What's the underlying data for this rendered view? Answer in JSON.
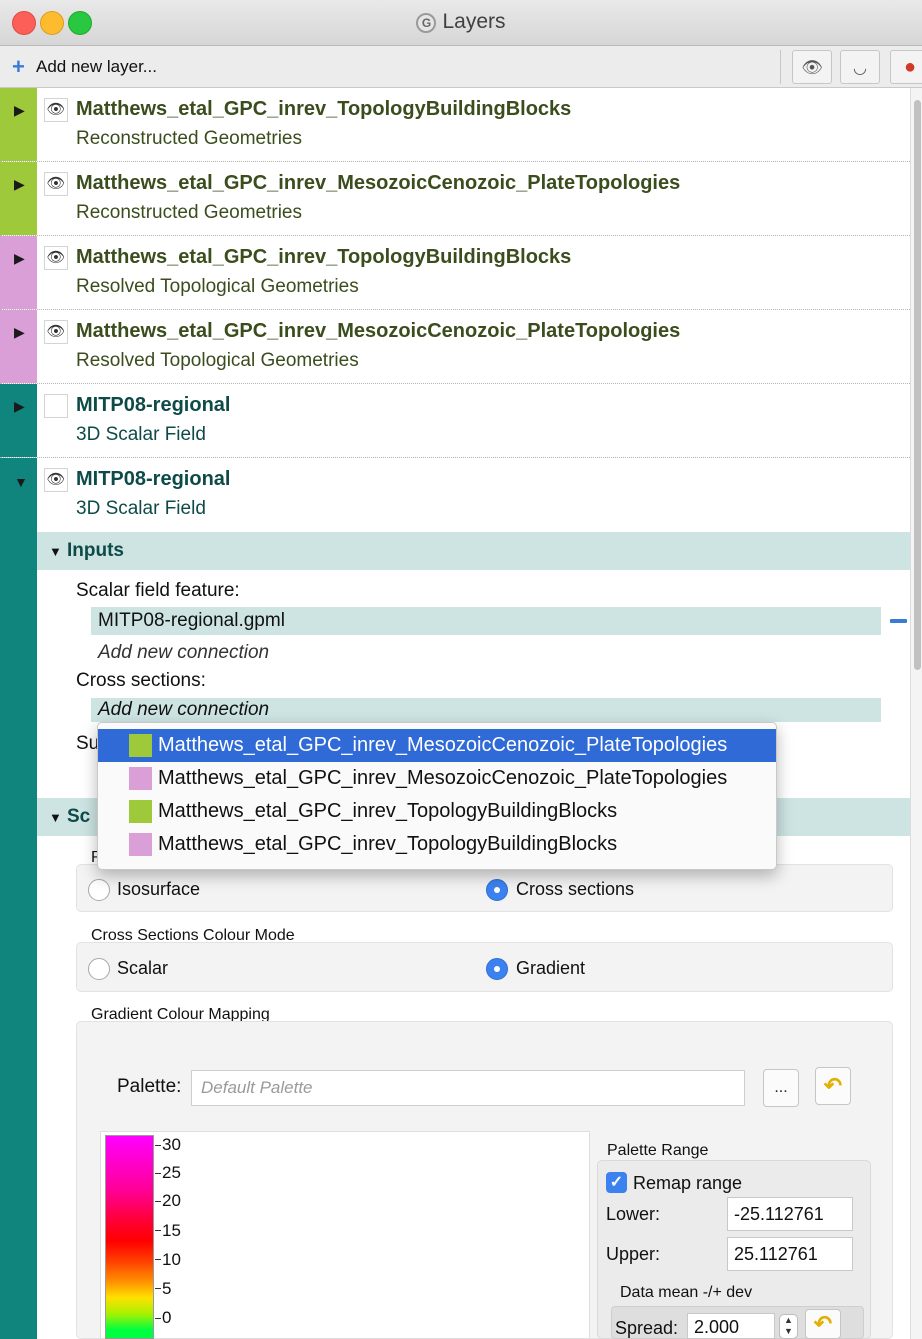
{
  "window": {
    "title": "Layers",
    "app_icon": "G"
  },
  "toolbar": {
    "add_layer_label": "Add new layer...",
    "buttons": [
      {
        "name": "show-all-layers",
        "icon": "eye-icon",
        "glyph": "👁"
      },
      {
        "name": "hide-all-layers",
        "icon": "eye-closed-icon",
        "glyph": "◡"
      },
      {
        "name": "layer-colors",
        "icon": "color-balls-icon",
        "glyph": "●"
      }
    ]
  },
  "layers": [
    {
      "name": "Matthews_etal_GPC_inrev_TopologyBuildingBlocks",
      "type": "Reconstructed Geometries",
      "color": "#9dc93a",
      "visible": true,
      "expanded": false
    },
    {
      "name": "Matthews_etal_GPC_inrev_MesozoicCenozoic_PlateTopologies",
      "type": "Reconstructed Geometries",
      "color": "#9dc93a",
      "visible": true,
      "expanded": false
    },
    {
      "name": "Matthews_etal_GPC_inrev_TopologyBuildingBlocks",
      "type": "Resolved Topological Geometries",
      "color": "#d99fd6",
      "visible": true,
      "expanded": false
    },
    {
      "name": "Matthews_etal_GPC_inrev_MesozoicCenozoic_PlateTopologies",
      "type": "Resolved Topological Geometries",
      "color": "#d99fd6",
      "visible": true,
      "expanded": false
    },
    {
      "name": "MITP08-regional",
      "type": "3D Scalar Field",
      "color": "#0f857e",
      "visible": false,
      "expanded": false
    },
    {
      "name": "MITP08-regional",
      "type": "3D Scalar Field",
      "color": "#0f857e",
      "visible": true,
      "expanded": true
    }
  ],
  "inputs": {
    "section_label": "Inputs",
    "scalar_field_label": "Scalar field feature:",
    "scalar_field_value": "MITP08-regional.gpml",
    "add_connection_1": "Add new connection",
    "cross_sections_label": "Cross sections:",
    "add_connection_2": "Add new connection",
    "surface_label_partial": "Su"
  },
  "popup": {
    "items": [
      {
        "label": "Matthews_etal_GPC_inrev_MesozoicCenozoic_PlateTopologies",
        "color": "#9dc93a",
        "selected": true
      },
      {
        "label": "Matthews_etal_GPC_inrev_MesozoicCenozoic_PlateTopologies",
        "color": "#d99fd6",
        "selected": false
      },
      {
        "label": "Matthews_etal_GPC_inrev_TopologyBuildingBlocks",
        "color": "#9dc93a",
        "selected": false
      },
      {
        "label": "Matthews_etal_GPC_inrev_TopologyBuildingBlocks",
        "color": "#d99fd6",
        "selected": false
      }
    ]
  },
  "scalar_options": {
    "section_label_partial": "Sc",
    "render_mode_label_partial": "R",
    "render_mode_options": [
      "Isosurface",
      "Cross sections"
    ],
    "render_mode_selected": "Cross sections",
    "colour_mode_title": "Cross Sections Colour Mode",
    "colour_mode_options": [
      "Scalar",
      "Gradient"
    ],
    "colour_mode_selected": "Gradient",
    "gradient_mapping_title": "Gradient Colour Mapping",
    "palette_label": "Palette:",
    "palette_placeholder": "Default Palette",
    "palette_browse_label": "...",
    "colorbar_ticks": [
      "30",
      "25",
      "20",
      "15",
      "10",
      "5",
      "0"
    ],
    "palette_range": {
      "title": "Palette Range",
      "remap_label": "Remap range",
      "remap_checked": true,
      "lower_label": "Lower:",
      "lower_value": "-25.112761",
      "upper_label": "Upper:",
      "upper_value": "25.112761",
      "mean_dev_title": "Data mean -/+ dev",
      "spread_label": "Spread:",
      "spread_value": "2.000"
    }
  }
}
